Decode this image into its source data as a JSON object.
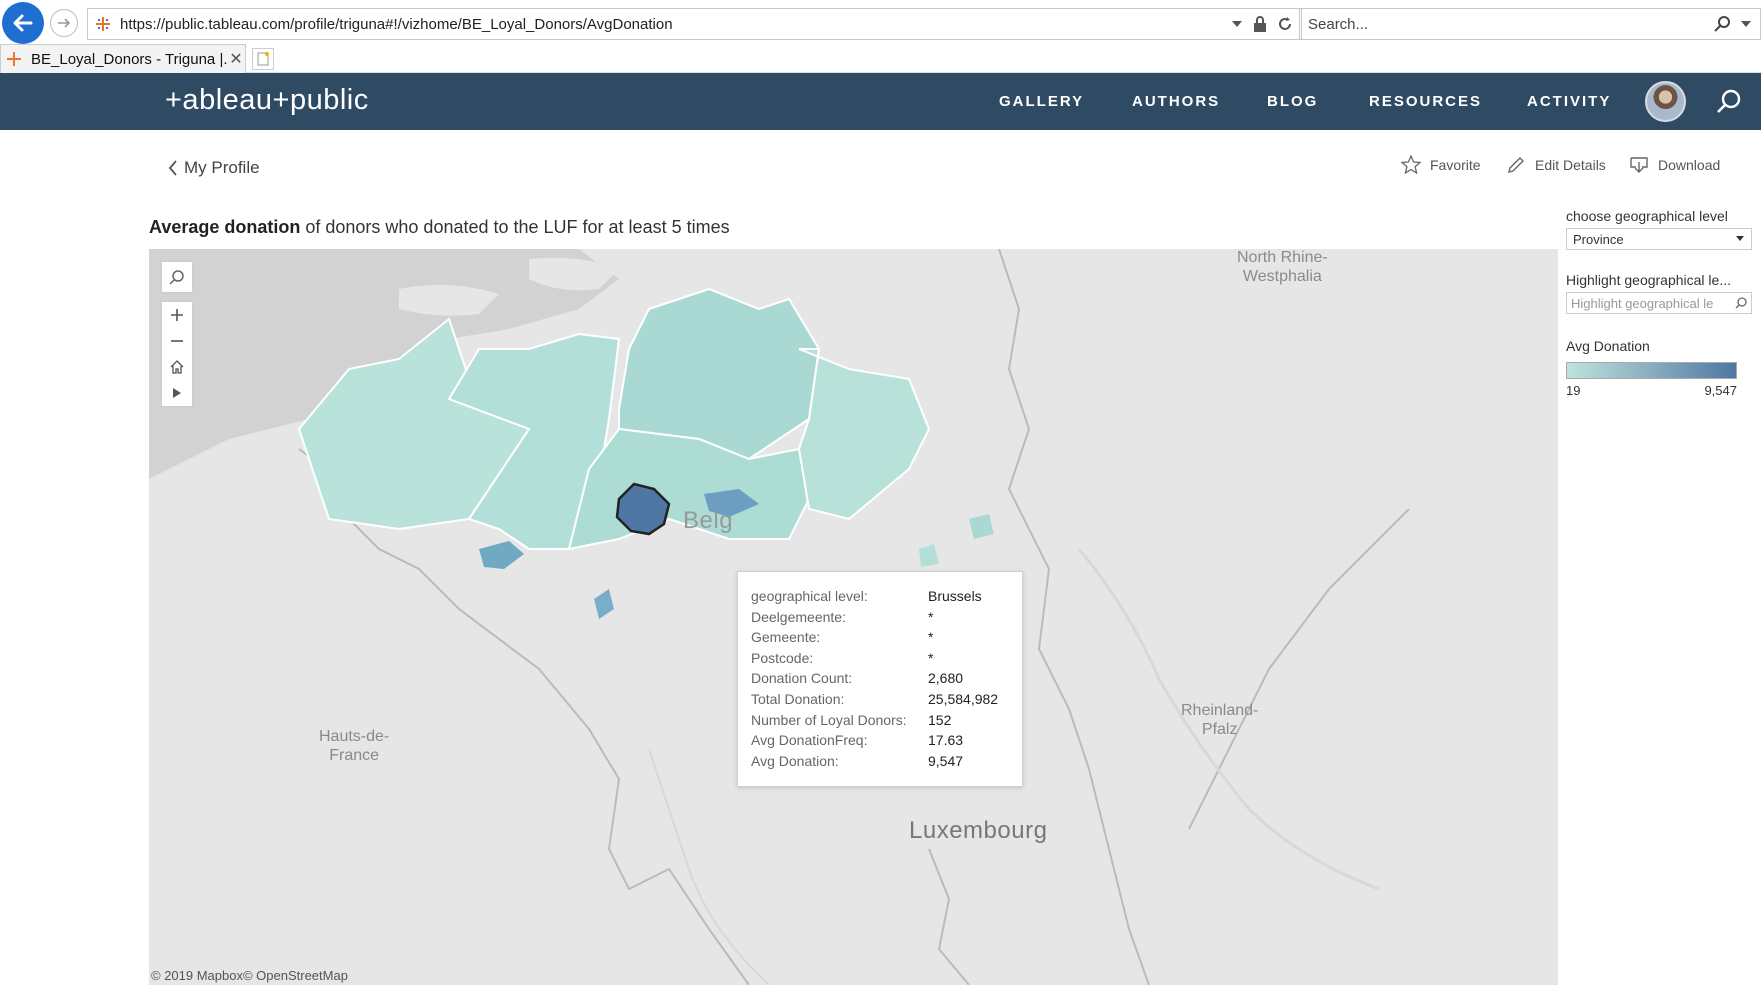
{
  "browser": {
    "url": "https://public.tableau.com/profile/triguna#!/vizhome/BE_Loyal_Donors/AvgDonation",
    "search_placeholder": "Search...",
    "tab_title": "BE_Loyal_Donors - Triguna |...",
    "tab_close": "✕"
  },
  "header": {
    "logo": "+ableau+public",
    "nav": [
      "GALLERY",
      "AUTHORS",
      "BLOG",
      "RESOURCES",
      "ACTIVITY"
    ]
  },
  "profile": {
    "back_label": "My Profile",
    "actions": {
      "favorite": "Favorite",
      "edit": "Edit Details",
      "download": "Download"
    }
  },
  "viz": {
    "title_bold": "Average donation",
    "title_rest": " of donors who donated to the LUF for at least 5 times",
    "map_labels": {
      "nrw": "North Rhine-\nWestphalia",
      "hauts": "Hauts-de-\nFrance",
      "rheinland": "Rheinland-\nPfalz",
      "luxembourg": "Luxembourg",
      "belgium_partial": "Belg"
    },
    "attribution": "© 2019 Mapbox© OpenStreetMap",
    "tooltip": [
      {
        "k": "geographical level:",
        "v": "Brussels"
      },
      {
        "k": "Deelgemeente:",
        "v": "*"
      },
      {
        "k": "Gemeente:",
        "v": "*"
      },
      {
        "k": "Postcode:",
        "v": "*"
      },
      {
        "k": "Donation Count:",
        "v": "2,680"
      },
      {
        "k": "Total Donation:",
        "v": "25,584,982"
      },
      {
        "k": "Number of Loyal Donors:",
        "v": "152"
      },
      {
        "k": "Avg DonationFreq:",
        "v": "17.63"
      },
      {
        "k": "Avg Donation:",
        "v": "9,547"
      }
    ],
    "colors": {
      "low": "#bfe3dc",
      "high": "#4f77a3",
      "mid": "#a9dad3"
    }
  },
  "panel": {
    "geo_label": "choose geographical level",
    "geo_value": "Province",
    "highlight_label": "Highlight geographical le...",
    "highlight_placeholder": "Highlight geographical le",
    "legend_title": "Avg Donation",
    "legend_min": "19",
    "legend_max": "9,547"
  }
}
